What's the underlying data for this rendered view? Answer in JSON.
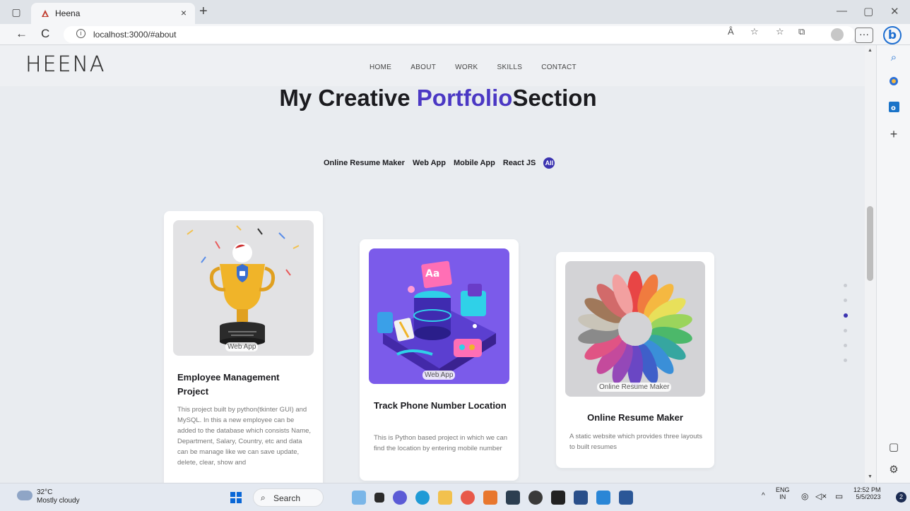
{
  "browser": {
    "tab_title": "Heena",
    "tab_close": "×",
    "new_tab": "+",
    "url": "localhost:3000/#about",
    "back_icon": "←",
    "reload_icon": "C",
    "info_icon": "i",
    "read_aloud": "Â",
    "more": "···",
    "bing": "b",
    "minimize": "—",
    "restore": "▢",
    "close": "✕"
  },
  "site": {
    "logo": "HEENA",
    "menu": [
      "HOME",
      "ABOUT",
      "WORK",
      "SKILLS",
      "CONTACT"
    ],
    "heading_part1": "My Creative ",
    "heading_accent": "Portfolio",
    "heading_part2": "Section",
    "filters": [
      "Online Resume Maker",
      "Web App",
      "Mobile App",
      "React JS"
    ],
    "filter_active": "All",
    "accent_color": "#4b38c4"
  },
  "cards": [
    {
      "tag": "Web App",
      "title": "Employee Management Project",
      "description": "This project built by python(tkinter GUI) and MySQL. In this a new employee can be added to the database which consists Name, Department, Salary, Country, etc and data can be manage like we can save update, delete, clear, show and"
    },
    {
      "tag": "Web App",
      "title": "Track Phone Number Location",
      "description": "This is Python based project in which we can find the location by entering mobile number"
    },
    {
      "tag": "Online Resume Maker",
      "title": "Online Resume Maker",
      "description": "A static website which provides three layouts to built resumes"
    }
  ],
  "dots": {
    "count": 6,
    "active_index": 2
  },
  "taskbar": {
    "temperature": "32°C",
    "weather": "Mostly cloudy",
    "search": "Search",
    "lang1": "ENG",
    "lang2": "IN",
    "time": "12:52 PM",
    "date": "5/5/2023",
    "notification_count": "2"
  }
}
